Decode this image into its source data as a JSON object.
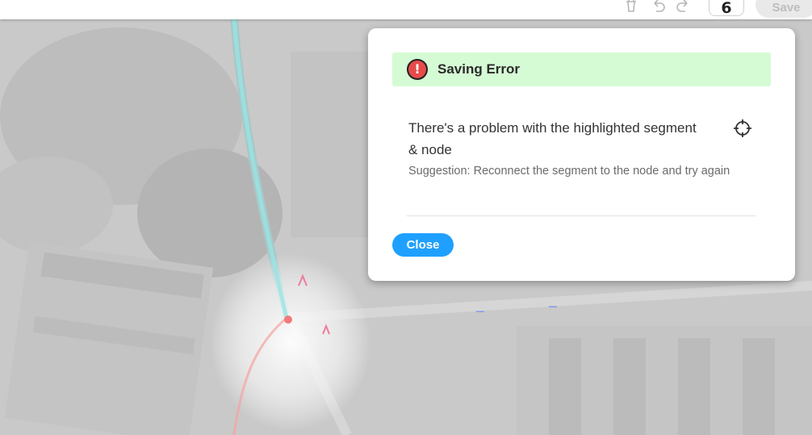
{
  "toolbar": {
    "counter_value": "6",
    "save_label": "Save",
    "icons": [
      "trash-icon",
      "undo-icon",
      "redo-icon"
    ]
  },
  "dialog": {
    "title": "Saving Error",
    "error_icon_glyph": "!",
    "message": "There's a problem with the highlighted segment & node",
    "suggestion": "Suggestion: Reconnect the segment to the node and try again",
    "close_label": "Close",
    "header_color": "#d5fbd5",
    "close_button_color": "#1fa0ff",
    "error_icon_color": "#e64b4b"
  }
}
